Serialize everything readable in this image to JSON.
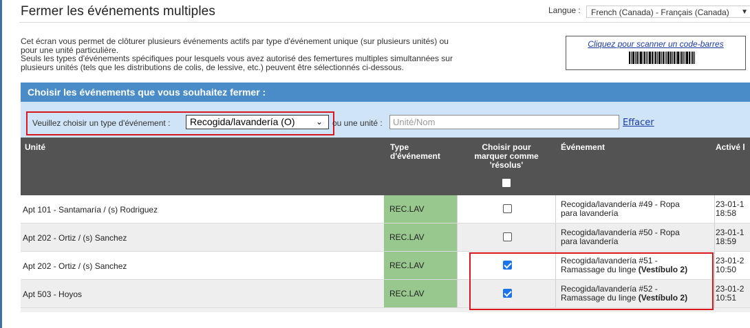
{
  "page": {
    "title": "Fermer les événements multiples",
    "language_label": "Langue :",
    "language_value": "French (Canada) - Français (Canada)"
  },
  "intro": {
    "line1": "Cet écran vous permet de clôturer plusieurs événements actifs par type d'événement unique (sur plusieurs unités) ou",
    "line2": "pour une unité particulière.",
    "line3": "Seuls les types d'événements spécifiques pour lesquels vous avez autorisé des femertures multiples simultannées sur",
    "line4": "plusieurs unités (tels que les distributions de colis, de lessive, etc.) peuvent être sélectionnés ci-dessous."
  },
  "barcode": {
    "link_label": "Cliquez pour scanner un code-barres"
  },
  "section": {
    "header": "Choisir les événements que vous souhaitez fermer :"
  },
  "filter": {
    "type_label": "Veuillez choisir un type d'événement :",
    "type_value": "Recogida/lavandería (O)",
    "unit_label": "ou une unité :",
    "unit_placeholder": "Unité/Nom",
    "clear_label": "Effacer"
  },
  "table": {
    "headers": {
      "unit": "Unité",
      "type_line1": "Type",
      "type_line2": "d'événement",
      "select_line1": "Choisir pour",
      "select_line2": "marquer comme",
      "select_line3": "'résolus'",
      "event": "Événement",
      "active": "Activé l"
    },
    "rows": [
      {
        "unit": "Apt 101 - Santamaría / (s) Rodriguez",
        "type": "REC.LAV",
        "checked": false,
        "event_line1": "Recogida/lavandería #49 - Ropa",
        "event_line2": "para lavandería",
        "event_bold": "",
        "date_line1": "23-01-1",
        "date_line2": "18:58"
      },
      {
        "unit": "Apt 202 - Ortiz / (s) Sanchez",
        "type": "REC.LAV",
        "checked": false,
        "event_line1": "Recogida/lavandería #50 - Ropa",
        "event_line2": "para lavandería",
        "event_bold": "",
        "date_line1": "23-01-1",
        "date_line2": "18:59"
      },
      {
        "unit": "Apt 202 - Ortiz / (s) Sanchez",
        "type": "REC.LAV",
        "checked": true,
        "event_line1": "Recogida/lavandería #51 -",
        "event_line2": "Ramassage du linge ",
        "event_bold": "(Vestíbulo 2)",
        "date_line1": "23-01-2",
        "date_line2": "10:50"
      },
      {
        "unit": "Apt 503 - Hoyos",
        "type": "REC.LAV",
        "checked": true,
        "event_line1": "Recogida/lavandería #52 -",
        "event_line2": "Ramassage du linge ",
        "event_bold": "(Vestíbulo 2)",
        "date_line1": "23-01-2",
        "date_line2": "10:51"
      }
    ]
  }
}
